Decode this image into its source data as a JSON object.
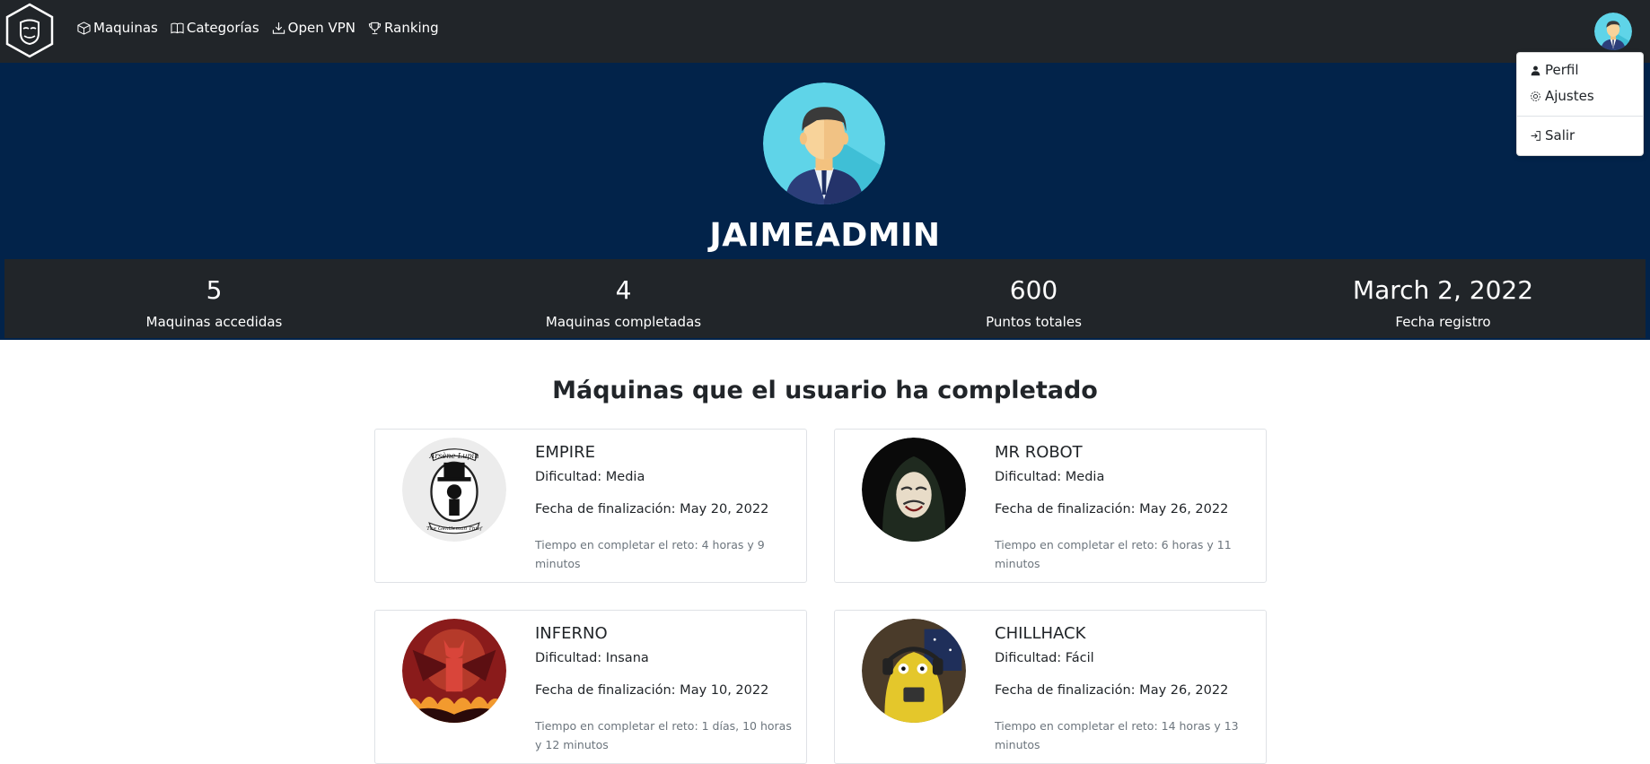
{
  "navbar": {
    "links": [
      {
        "label": "Maquinas",
        "icon": "box-icon"
      },
      {
        "label": "Categorías",
        "icon": "book-icon"
      },
      {
        "label": "Open VPN",
        "icon": "download-icon"
      },
      {
        "label": "Ranking",
        "icon": "trophy-icon"
      }
    ]
  },
  "dropdown": {
    "items": [
      {
        "label": "Perfil",
        "icon": "person-icon"
      },
      {
        "label": "Ajustes",
        "icon": "gear-icon"
      },
      {
        "label": "Salir",
        "icon": "logout-icon"
      }
    ]
  },
  "profile": {
    "username": "JAIMEADMIN",
    "stats": [
      {
        "value": "5",
        "label": "Maquinas accedidas"
      },
      {
        "value": "4",
        "label": "Maquinas completadas"
      },
      {
        "value": "600",
        "label": "Puntos totales"
      },
      {
        "value": "March 2, 2022",
        "label": "Fecha registro"
      }
    ]
  },
  "completed": {
    "title": "Máquinas que el usuario ha completado",
    "cards": [
      {
        "name": "EMPIRE",
        "difficulty": "Dificultad: Media",
        "date": "Fecha de finalización: May 20, 2022",
        "time": "Tiempo en completar el reto: 4 horas y 9 minutos",
        "image": "arsene-lupin-logo",
        "logo_top": "Arsène Lupin",
        "logo_bottom": "The Gentleman Thief"
      },
      {
        "name": "MR ROBOT",
        "difficulty": "Dificultad: Media",
        "date": "Fecha de finalización: May 26, 2022",
        "time": "Tiempo en completar el reto: 6 horas y 11 minutos",
        "image": "mask-hood-image"
      },
      {
        "name": "INFERNO",
        "difficulty": "Dificultad: Insana",
        "date": "Fecha de finalización: May 10, 2022",
        "time": "Tiempo en completar el reto: 1 días, 10 horas y 12 minutos",
        "image": "demon-image"
      },
      {
        "name": "CHILLHACK",
        "difficulty": "Dificultad: Fácil",
        "date": "Fecha de finalización: May 26, 2022",
        "time": "Tiempo en completar el reto: 14 horas y 13 minutos",
        "image": "yellow-dog-image"
      }
    ]
  },
  "colors": {
    "navbar": "#212529",
    "hero": "#02234a",
    "stats_bar": "#212529"
  }
}
